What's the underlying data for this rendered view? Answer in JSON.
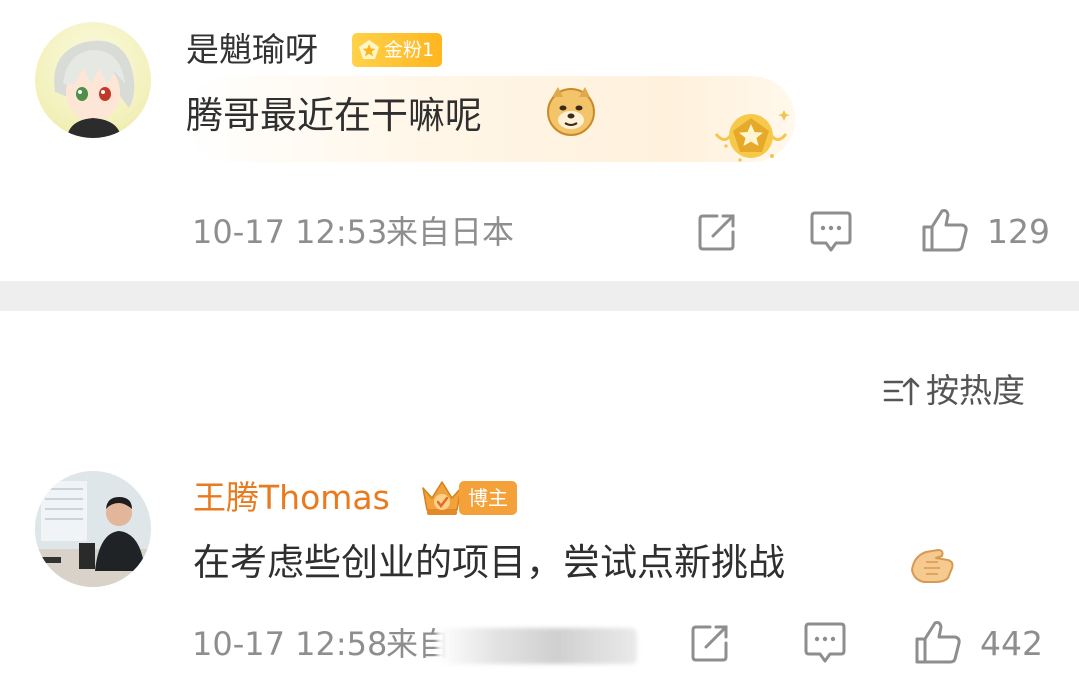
{
  "comments": [
    {
      "username": "是魈瑜呀",
      "badge": "金粉1",
      "text": "腾哥最近在干嘛呢",
      "emoji": "doge-emoji",
      "time": "10-17 12:53",
      "location": "来自日本",
      "likes": "129",
      "badge_color": "#ffb51f"
    },
    {
      "username": "王腾Thomas",
      "badge": "博主",
      "text": "在考虑些创业的项目，尝试点新挑战",
      "emoji": "handshake-emoji",
      "time": "10-17 12:58",
      "location": "来自",
      "likes": "442",
      "name_color": "#ea7a1e",
      "badge_color": "#f4a13a"
    }
  ],
  "sort": {
    "label": "按热度",
    "icon": "sort-icon"
  },
  "colors": {
    "divider": "#eeeeee",
    "meta_text": "#8e8e8e"
  }
}
